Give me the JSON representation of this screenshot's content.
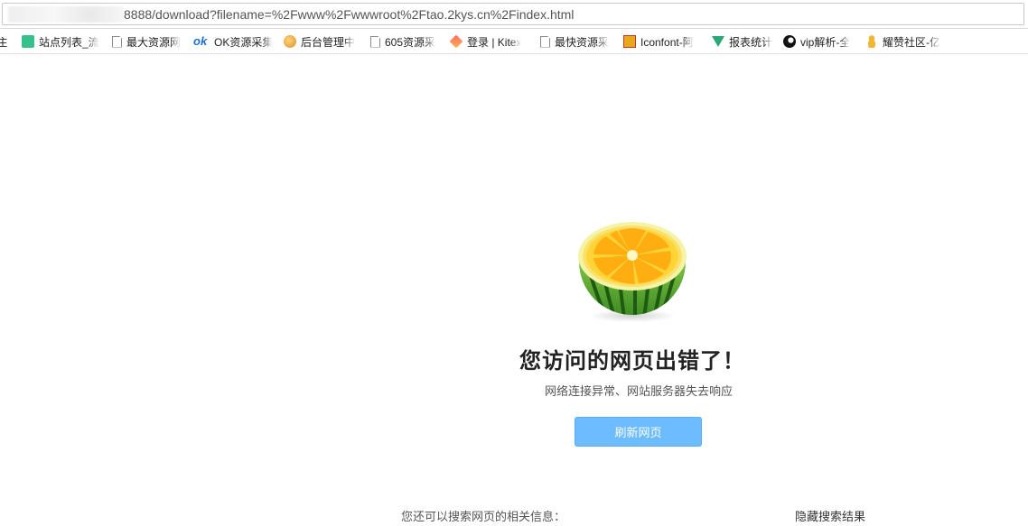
{
  "address_bar": {
    "url": "8888/download?filename=%2Fwww%2Fwwwroot%2Ftao.2kys.cn%2Findex.html"
  },
  "bookmarks": [
    {
      "label": "主",
      "icon": "none"
    },
    {
      "label": "站点列表_流",
      "icon": "book-icon"
    },
    {
      "label": "最大资源网",
      "icon": "page-icon"
    },
    {
      "label": "OK资源采集",
      "icon": "ok-icon"
    },
    {
      "label": "后台管理中",
      "icon": "face-icon"
    },
    {
      "label": "605资源采",
      "icon": "page-icon"
    },
    {
      "label": "登录 | Kitex",
      "icon": "kite-icon"
    },
    {
      "label": "最快资源采",
      "icon": "page-icon"
    },
    {
      "label": "Iconfont-阿",
      "icon": "iconfont-icon"
    },
    {
      "label": "报表统计",
      "icon": "v-icon"
    },
    {
      "label": "vip解析-全",
      "icon": "vip-icon"
    },
    {
      "label": "耀赞社区-亿",
      "icon": "gourd-icon"
    }
  ],
  "error_page": {
    "title": "您访问的网页出错了！",
    "subtitle": "网络连接异常、网站服务器失去响应",
    "refresh_label": "刷新网页",
    "search_hint": "您还可以搜索网页的相关信息：",
    "hide_results_label": "隐藏搜索结果"
  },
  "colors": {
    "button_bg": "#6cbcff",
    "lemon_yellow": "#ffc21f",
    "rind_green": "#4a9a2a"
  }
}
